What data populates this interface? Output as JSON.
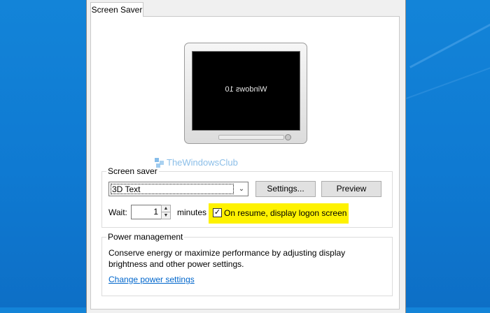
{
  "tab": {
    "label": "Screen Saver"
  },
  "preview": {
    "screen_text": "Windows 10"
  },
  "watermark": {
    "text": "TheWindowsClub"
  },
  "screen_saver": {
    "legend": "Screen saver",
    "selected": "3D Text",
    "settings_label": "Settings...",
    "preview_label": "Preview",
    "wait_label": "Wait:",
    "wait_value": "1",
    "minutes_label": "minutes",
    "resume_checked": true,
    "resume_label": "On resume, display logon screen"
  },
  "power": {
    "legend": "Power management",
    "description_line1": "Conserve energy or maximize performance by adjusting display",
    "description_line2": "brightness and other power settings.",
    "link_label": "Change power settings"
  },
  "colors": {
    "highlight": "#fef200",
    "link": "#0066cc",
    "desktop": "#1384d8"
  }
}
